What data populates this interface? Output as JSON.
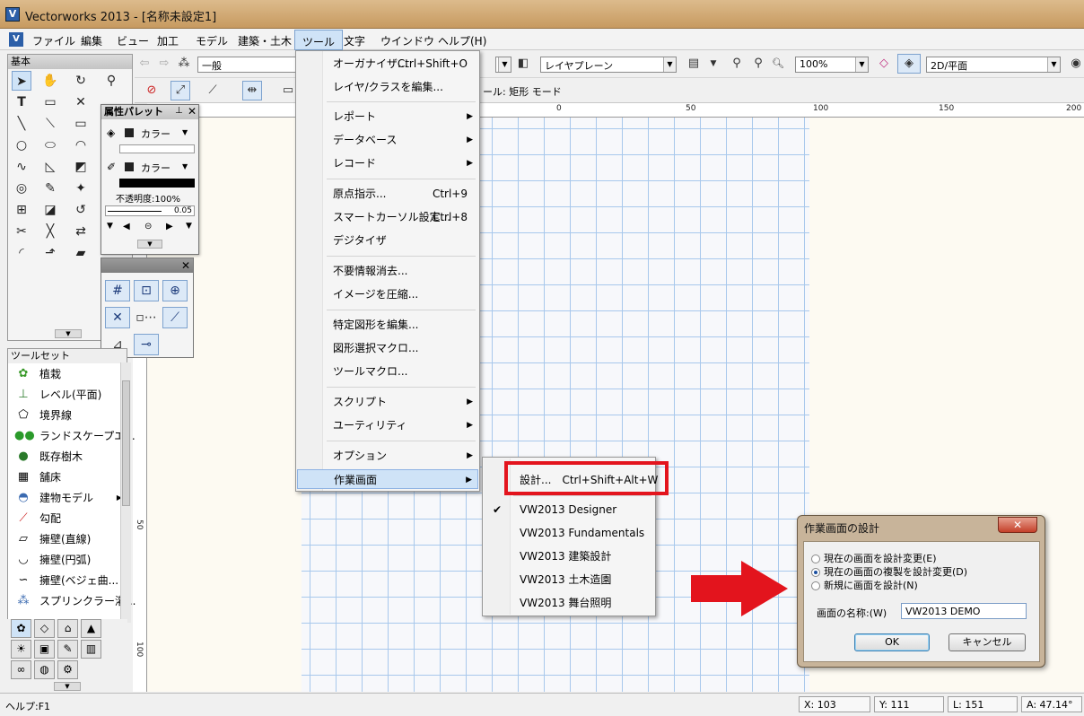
{
  "window": {
    "title": "Vectorworks 2013 - [名称未設定1]"
  },
  "menubar": {
    "items": [
      "ファイル",
      "編集",
      "ビュー",
      "加工",
      "モデル",
      "建築・土木",
      "ツール",
      "文字",
      "ウインドウ",
      "ヘルプ(H)"
    ]
  },
  "toolbar": {
    "class_combo": "一般",
    "layer_combo": "レイヤプレーン",
    "zoom_combo": "100%",
    "view_combo": "2D/平面",
    "mode_text": "ール: 矩形 モード"
  },
  "basic_palette": {
    "title": "基本"
  },
  "attr_palette": {
    "title": "属性パレット",
    "fill_label": "カラー",
    "pen_label": "カラー",
    "opacity": "不透明度:100%",
    "line_weight": "0.05"
  },
  "toolset_palette": {
    "title": "ツールセット",
    "items": [
      "植栽",
      "レベル(平面)",
      "境界線",
      "ランドスケープエ...",
      "既存樹木",
      "舗床",
      "建物モデル",
      "勾配",
      "擁壁(直線)",
      "擁壁(円弧)",
      "擁壁(ベジェ曲...",
      "スプリンクラー灌..."
    ]
  },
  "ruler": {
    "h": [
      "0",
      "50",
      "100",
      "150",
      "200"
    ],
    "v": [
      "50",
      "100"
    ]
  },
  "tool_menu": {
    "items": [
      {
        "label": "オーガナイザ...",
        "shortcut": "Ctrl+Shift+O"
      },
      {
        "label": "レイヤ/クラスを編集..."
      },
      {
        "label": "レポート",
        "submenu": true
      },
      {
        "label": "データベース",
        "submenu": true
      },
      {
        "label": "レコード",
        "submenu": true
      },
      {
        "label": "原点指示...",
        "shortcut": "Ctrl+9"
      },
      {
        "label": "スマートカーソル設定...",
        "shortcut": "Ctrl+8"
      },
      {
        "label": "デジタイザ"
      },
      {
        "label": "不要情報消去..."
      },
      {
        "label": "イメージを圧縮..."
      },
      {
        "label": "特定図形を編集..."
      },
      {
        "label": "図形選択マクロ..."
      },
      {
        "label": "ツールマクロ..."
      },
      {
        "label": "スクリプト",
        "submenu": true
      },
      {
        "label": "ユーティリティ",
        "submenu": true
      },
      {
        "label": "オプション",
        "submenu": true
      },
      {
        "label": "作業画面",
        "submenu": true
      }
    ]
  },
  "workspace_submenu": {
    "design": "設計...",
    "design_shortcut": "Ctrl+Shift+Alt+W",
    "items": [
      "VW2013 Designer",
      "VW2013 Fundamentals",
      "VW2013 建築設計",
      "VW2013 土木造園",
      "VW2013 舞台照明"
    ]
  },
  "dialog": {
    "title": "作業画面の設計",
    "options": [
      "現在の画面を設計変更(E)",
      "現在の画面の複製を設計変更(D)",
      "新規に画面を設計(N)"
    ],
    "selected": 1,
    "name_label": "画面の名称:(W)",
    "name_value": "VW2013 DEMO",
    "ok": "OK",
    "cancel": "キャンセル"
  },
  "statusbar": {
    "help": "ヘルプ:F1",
    "x": "X: 103",
    "y": "Y: 111",
    "l": "L: 151",
    "a": "A: 47.14°"
  },
  "colors": {
    "highlight": "#cfe3f7",
    "annotation_red": "#e3141d",
    "grid_line": "#a8c8ec"
  }
}
